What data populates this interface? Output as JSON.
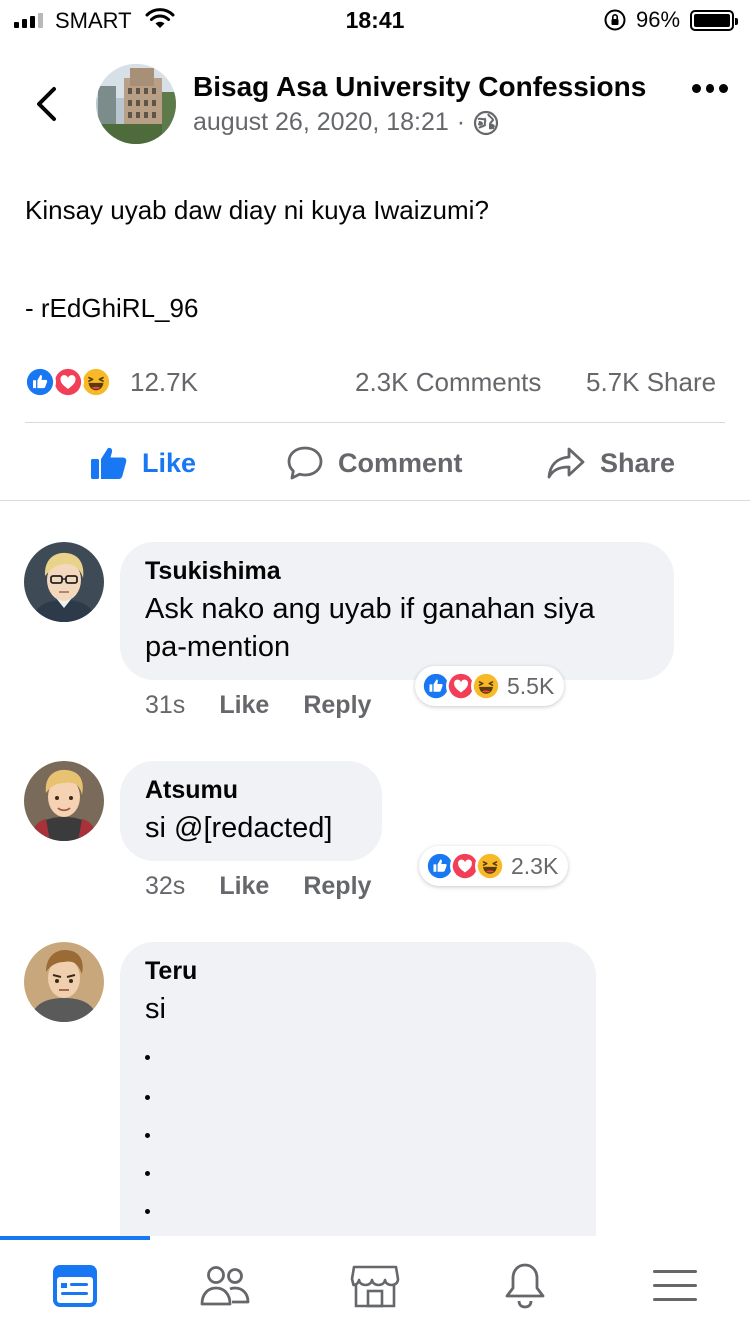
{
  "status_bar": {
    "carrier": "SMART",
    "time": "18:41",
    "battery": "96%",
    "signal_bars_filled": 3,
    "signal_bars_total": 4,
    "battery_level": 0.96
  },
  "header": {
    "page_name": "Bisag Asa University Confessions",
    "timestamp": "august 26, 2020, 18:21",
    "separator": "·",
    "privacy_icon": "globe-icon"
  },
  "post": {
    "text": "Kinsay uyab daw diay ni kuya Iwaizumi?",
    "signature": "- rEdGhiRL_96",
    "reaction_count": "12.7K",
    "reaction_types": [
      "like",
      "love",
      "haha"
    ],
    "comments": "2.3K Comments",
    "shares": "5.7K Share"
  },
  "actions": {
    "like": "Like",
    "comment": "Comment",
    "share": "Share"
  },
  "comments": [
    {
      "author": "Tsukishima",
      "text_line1": "Ask nako ang uyab if ganahan siya",
      "text_line2": "pa-mention",
      "time": "31s",
      "like": "Like",
      "reply": "Reply",
      "reaction_count": "5.5K"
    },
    {
      "author": "Atsumu",
      "text_line1": "si @[redacted]",
      "time": "32s",
      "like": "Like",
      "reply": "Reply",
      "reaction_count": "2.3K"
    },
    {
      "author": "Teru",
      "text_line1": "si",
      "trailing_dots": 5
    }
  ],
  "bottom_nav": {
    "items": [
      "news-feed-icon",
      "friends-icon",
      "marketplace-icon",
      "notifications-icon",
      "menu-icon"
    ],
    "active": "news-feed-icon"
  },
  "colors": {
    "brand_blue": "#1877f2",
    "love_red": "#f33e58",
    "haha_yellow": "#f7b928",
    "secondary_text": "#65676b",
    "bubble_bg": "#f0f2f5"
  }
}
